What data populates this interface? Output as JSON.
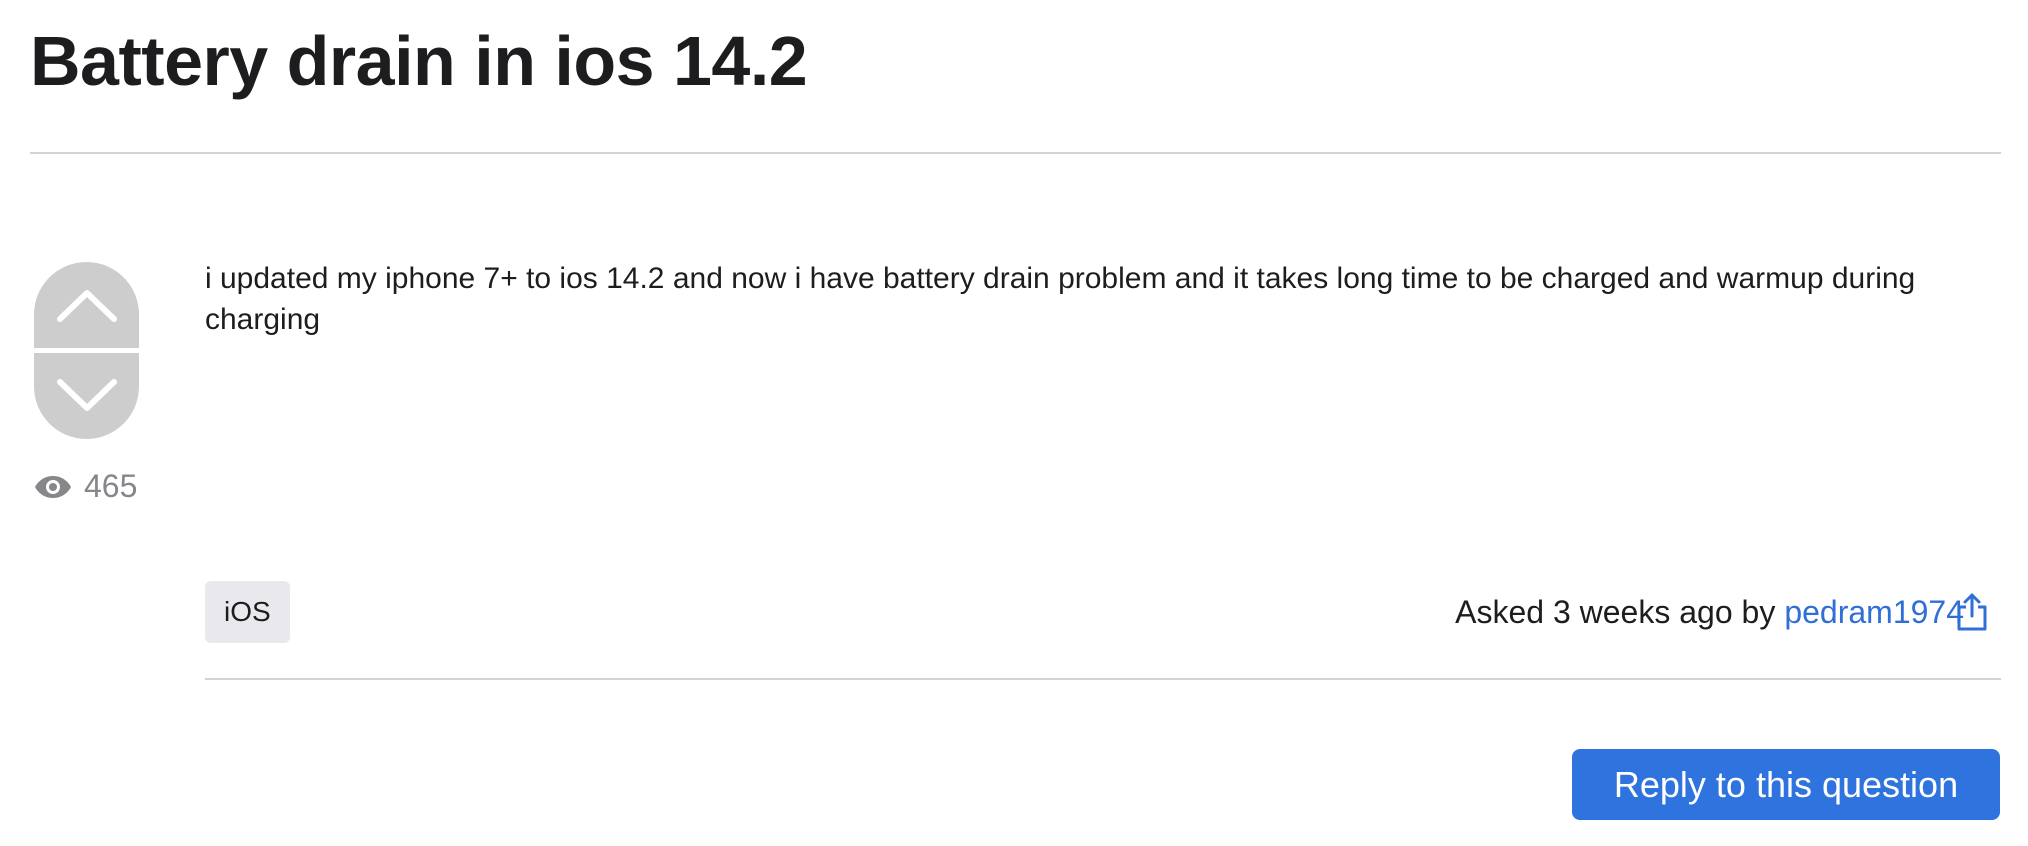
{
  "question": {
    "title": "Battery drain in ios 14.2",
    "body": "i updated my iphone 7+ to ios 14.2 and now i have battery drain problem and it takes long time to be charged and warmup during charging",
    "view_count": "465",
    "tag": "iOS",
    "asked_label": "Asked 3 weeks ago by",
    "author": "pedram1974"
  },
  "actions": {
    "reply_label": "Reply to this question"
  },
  "icons": {
    "vote_up": "chevron-up-icon",
    "vote_down": "chevron-down-icon",
    "views": "eye-icon",
    "share": "share-icon"
  },
  "colors": {
    "link": "#2f6fd6",
    "primary_button": "#2f73de",
    "vote_pill": "#cdcdcd",
    "tag_background": "#e8e8ed"
  }
}
